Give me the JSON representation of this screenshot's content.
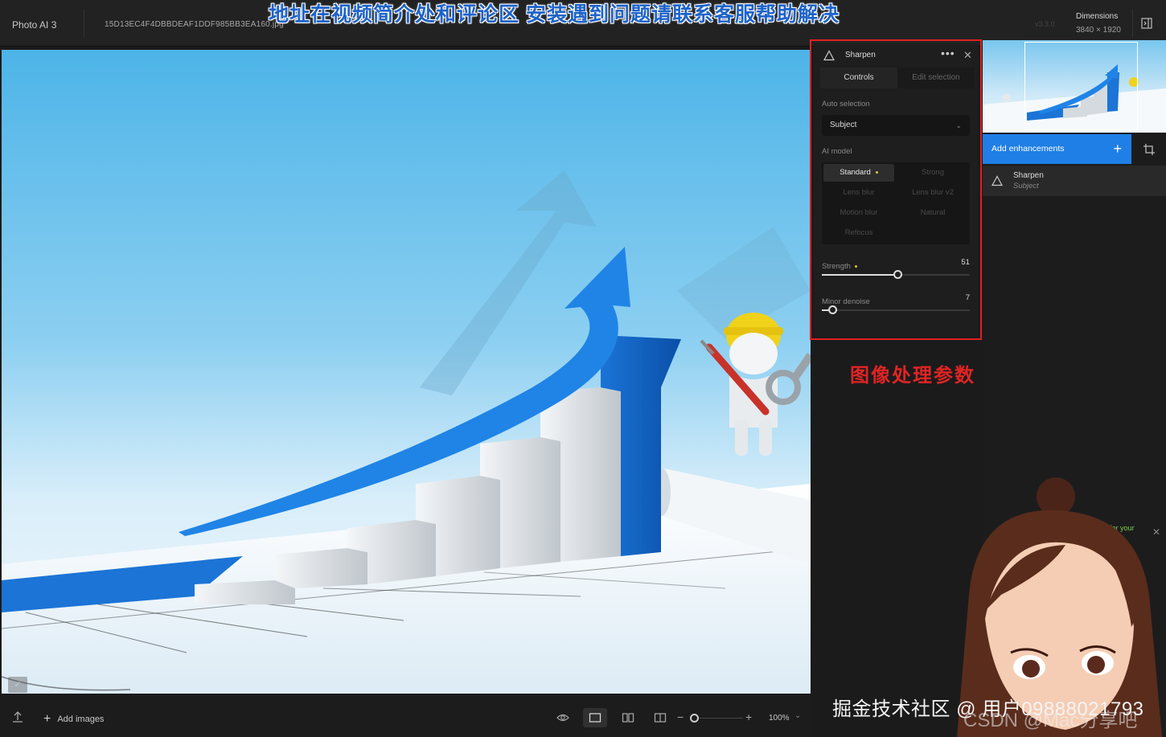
{
  "header": {
    "app_name": "Photo AI  3",
    "file_name": "15D13EC4F4DBBDEAF1DDF985BB3EA160.jpg",
    "version": "v3.3.0",
    "dimensions_label": "Dimensions",
    "dimensions_value": "3840 × 1920",
    "banner": "地址在视频简介处和评论区 安装遇到问题请联系客服帮助解决"
  },
  "panel": {
    "title": "Sharpen",
    "more_icon": "more-icon",
    "tabs": [
      {
        "label": "Controls",
        "active": true
      },
      {
        "label": "Edit selection",
        "active": false
      }
    ],
    "auto_selection_label": "Auto selection",
    "auto_selection_value": "Subject",
    "ai_model_label": "AI model",
    "models": [
      {
        "label": "Standard",
        "active": true
      },
      {
        "label": "Strong",
        "active": false
      },
      {
        "label": "Lens blur",
        "active": false
      },
      {
        "label": "Lens blur v2",
        "active": false
      },
      {
        "label": "Motion blur",
        "active": false
      },
      {
        "label": "Natural",
        "active": false
      },
      {
        "label": "Refocus",
        "active": false
      }
    ],
    "strength": {
      "label": "Strength",
      "value": "51",
      "fraction": 0.51
    },
    "minor_denoise": {
      "label": "Minor denoise",
      "value": "7",
      "fraction": 0.07
    }
  },
  "annotation": "图像处理参数",
  "sidebar": {
    "add_enhancements": "Add enhancements",
    "enhancement": {
      "name": "Sharpen",
      "sub": "Subject"
    },
    "for_your": "for your"
  },
  "bottombar": {
    "add_images": "Add images",
    "zoom": "100%",
    "zoom_fraction": 0.0
  },
  "watermark": "掘金技术社区 @ 用户09888021793",
  "watermark2": "CSDN @Mac分享吧",
  "colors": {
    "accent": "#1f7fe6",
    "highlight_box": "#e02020",
    "active_dot": "#d8c93a"
  }
}
